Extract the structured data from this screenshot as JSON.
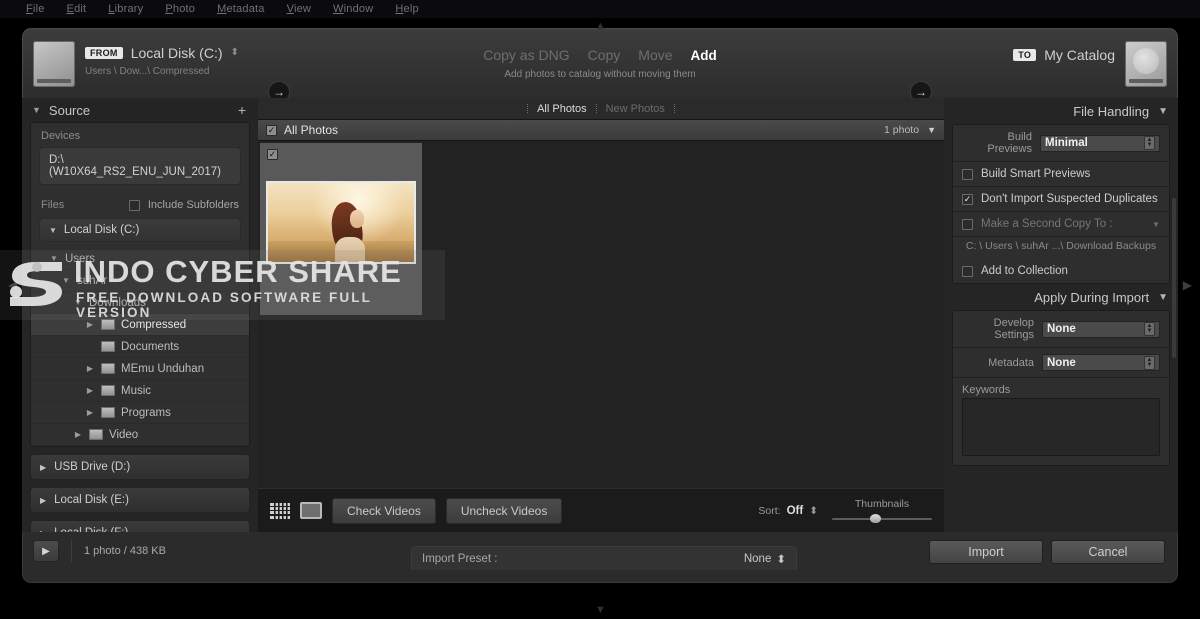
{
  "menu": {
    "items": [
      {
        "pre": "",
        "acc": "F",
        "post": "ile"
      },
      {
        "pre": "",
        "acc": "E",
        "post": "dit"
      },
      {
        "pre": "",
        "acc": "L",
        "post": "ibrary"
      },
      {
        "pre": "",
        "acc": "P",
        "post": "hoto"
      },
      {
        "pre": "",
        "acc": "M",
        "post": "etadata"
      },
      {
        "pre": "",
        "acc": "V",
        "post": "iew"
      },
      {
        "pre": "",
        "acc": "W",
        "post": "indow"
      },
      {
        "pre": "",
        "acc": "H",
        "post": "elp"
      }
    ]
  },
  "header": {
    "from_badge": "FROM",
    "source_name": "Local Disk (C:)",
    "source_path": "Users \\ Dow...\\ Compressed",
    "to_badge": "TO",
    "catalog_name": "My Catalog",
    "arrow_glyph": "→",
    "spinner_glyph": "⬍",
    "modes": [
      {
        "label": "Copy as DNG",
        "active": false
      },
      {
        "label": "Copy",
        "active": false
      },
      {
        "label": "Move",
        "active": false
      },
      {
        "label": "Add",
        "active": true
      }
    ],
    "mode_description": "Add photos to catalog without moving them"
  },
  "source_panel": {
    "title": "Source",
    "collapse_glyph": "▼",
    "add_glyph": "+",
    "devices_label": "Devices",
    "device_item": "D:\\(W10X64_RS2_ENU_JUN_2017)",
    "files_label": "Files",
    "include_subfolders_label": "Include Subfolders",
    "include_subfolders_checked": false,
    "root_disk": "Local Disk (C:)",
    "tree": [
      {
        "label": "Users",
        "depth": 1,
        "twisty": "▼",
        "folder": false,
        "selected": false
      },
      {
        "label": "suhAr",
        "depth": 2,
        "twisty": "▼",
        "folder": false,
        "selected": false
      },
      {
        "label": "Downloads",
        "depth": 3,
        "twisty": "▼",
        "folder": false,
        "selected": false
      },
      {
        "label": "Compressed",
        "depth": 4,
        "twisty": "▶",
        "folder": true,
        "selected": true
      },
      {
        "label": "Documents",
        "depth": 4,
        "twisty": "",
        "folder": true,
        "selected": false
      },
      {
        "label": "MEmu Unduhan",
        "depth": 4,
        "twisty": "▶",
        "folder": true,
        "selected": false
      },
      {
        "label": "Music",
        "depth": 4,
        "twisty": "▶",
        "folder": true,
        "selected": false
      },
      {
        "label": "Programs",
        "depth": 4,
        "twisty": "▶",
        "folder": true,
        "selected": false
      },
      {
        "label": "Video",
        "depth": 3,
        "twisty": "▶",
        "folder": true,
        "selected": false
      }
    ],
    "other_drives": [
      {
        "label": "USB Drive (D:)",
        "twisty": "▶"
      },
      {
        "label": "Local Disk (E:)",
        "twisty": "▶"
      },
      {
        "label": "Local Disk (F:)",
        "twisty": "▶"
      }
    ]
  },
  "center": {
    "filter_tabs": [
      {
        "label": "All Photos",
        "active": true
      },
      {
        "label": "New Photos",
        "active": false
      }
    ],
    "grid_header_label": "All Photos",
    "grid_header_checked": true,
    "photo_count": "1 photo",
    "disclosure_glyph": "▼",
    "check_glyph": "✓",
    "cell_checked": true,
    "toolbar": {
      "grid_view_icon": "grid-view-icon",
      "loupe_view_icon": "loupe-view-icon",
      "check_videos": "Check Videos",
      "uncheck_videos": "Uncheck Videos",
      "sort_label": "Sort:",
      "sort_value": "Off",
      "sort_stepper": "⬍",
      "thumbnails_label": "Thumbnails",
      "thumbnails_position_pct": 38
    }
  },
  "file_handling": {
    "title": "File Handling",
    "collapse_glyph": "▼",
    "build_previews_label": "Build Previews",
    "build_previews_value": "Minimal",
    "build_smart_previews_label": "Build Smart Previews",
    "build_smart_previews_checked": false,
    "dont_import_duplicates_label": "Don't Import Suspected Duplicates",
    "dont_import_duplicates_checked": true,
    "second_copy_label": "Make a Second Copy To :",
    "second_copy_checked": false,
    "second_copy_path": "C: \\ Users \\ suhAr ...\\ Download Backups",
    "add_to_collection_label": "Add to Collection",
    "add_to_collection_checked": false
  },
  "apply_during_import": {
    "title": "Apply During Import",
    "collapse_glyph": "▼",
    "develop_settings_label": "Develop Settings",
    "develop_settings_value": "None",
    "metadata_label": "Metadata",
    "metadata_value": "None",
    "keywords_label": "Keywords",
    "keywords_value": ""
  },
  "footer": {
    "play_glyph": "▶",
    "status": "1 photo / 438 KB",
    "preset_label": "Import Preset :",
    "preset_value": "None",
    "preset_stepper": "⬍",
    "import_button": "Import",
    "cancel_button": "Cancel"
  },
  "watermark": {
    "line1": "INDO CYBER SHARE",
    "line2": "FREE DOWNLOAD SOFTWARE FULL VERSION"
  },
  "colors": {
    "panel_bg": "#252525",
    "center_bg": "#222222",
    "accent_white": "#ffffff",
    "text_primary": "#cfcfcf",
    "text_muted": "#8c8c8c"
  }
}
